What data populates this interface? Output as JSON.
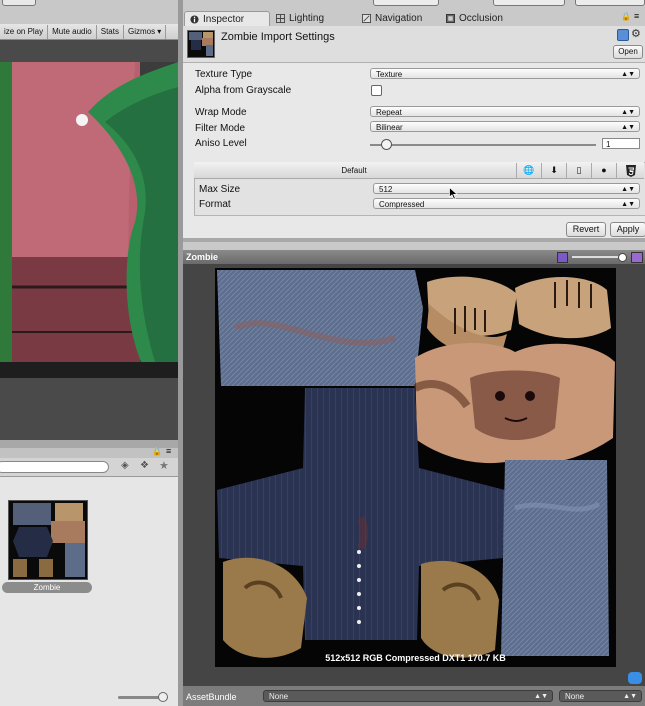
{
  "game_toolbar": {
    "items": [
      "ize on Play",
      "Mute audio",
      "Stats",
      "Gizmos ▾"
    ]
  },
  "project": {
    "asset_name": "Zombie"
  },
  "tabs": [
    {
      "label": "Inspector",
      "icon": "info-icon"
    },
    {
      "label": "Lighting",
      "icon": "lighting-icon"
    },
    {
      "label": "Navigation",
      "icon": "navigation-icon"
    },
    {
      "label": "Occlusion",
      "icon": "occlusion-icon"
    }
  ],
  "inspector": {
    "title": "Zombie Import Settings",
    "open_label": "Open",
    "texture_type": {
      "label": "Texture Type",
      "value": "Texture"
    },
    "alpha_from_grayscale": {
      "label": "Alpha from Grayscale",
      "checked": false
    },
    "wrap_mode": {
      "label": "Wrap Mode",
      "value": "Repeat"
    },
    "filter_mode": {
      "label": "Filter Mode",
      "value": "Bilinear"
    },
    "aniso_level": {
      "label": "Aniso Level",
      "value": "1"
    },
    "platform": {
      "default_label": "Default",
      "max_size": {
        "label": "Max Size",
        "value": "512"
      },
      "format": {
        "label": "Format",
        "value": "Compressed"
      }
    },
    "revert_label": "Revert",
    "apply_label": "Apply"
  },
  "preview": {
    "title": "Zombie",
    "info": "512x512  RGB Compressed DXT1   170.7 KB"
  },
  "asset_bundle": {
    "label": "AssetBundle",
    "name_value": "None",
    "variant_value": "None"
  },
  "colors": {
    "accent": "#3a8ee6"
  }
}
